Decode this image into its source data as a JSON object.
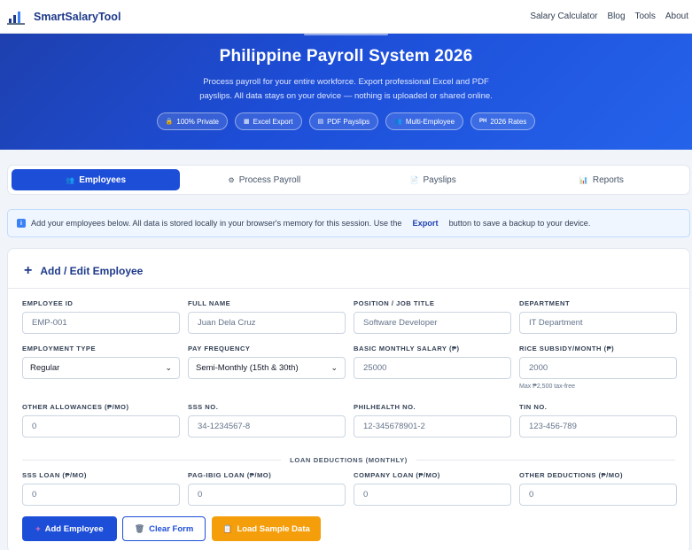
{
  "nav": {
    "brand": "SmartSalaryTool",
    "links": [
      "Salary Calculator",
      "Blog",
      "Tools",
      "About"
    ]
  },
  "hero": {
    "title": "Philippine Payroll System 2026",
    "desc_line1": "Process payroll for your entire workforce. Export professional Excel and PDF",
    "desc_line2": "payslips. All data stays on your device — nothing is uploaded or shared online.",
    "pills": [
      {
        "icon": "lock-icon",
        "label": "100% Private"
      },
      {
        "icon": "spreadsheet-icon",
        "label": "Excel Export"
      },
      {
        "icon": "document-icon",
        "label": "PDF Payslips"
      },
      {
        "icon": "people-icon",
        "label": "Multi-Employee"
      },
      {
        "icon": "ph-flag-icon",
        "label": "2026 Rates"
      }
    ]
  },
  "tabs": [
    {
      "icon": "people-icon",
      "label": "Employees",
      "active": true
    },
    {
      "icon": "gear-icon",
      "label": "Process Payroll",
      "active": false
    },
    {
      "icon": "document-icon",
      "label": "Payslips",
      "active": false
    },
    {
      "icon": "chart-icon",
      "label": "Reports",
      "active": false
    }
  ],
  "info": {
    "text_before": "Add your employees below. All data is stored locally in your browser's memory for this session. Use the",
    "bold": "Export",
    "text_after": "button to save a backup to your device."
  },
  "form": {
    "title": "Add / Edit Employee",
    "fields": {
      "employee_id": {
        "label": "EMPLOYEE ID",
        "placeholder": "EMP-001"
      },
      "full_name": {
        "label": "FULL NAME",
        "placeholder": "Juan Dela Cruz"
      },
      "position": {
        "label": "POSITION / JOB TITLE",
        "placeholder": "Software Developer"
      },
      "department": {
        "label": "DEPARTMENT",
        "placeholder": "IT Department"
      },
      "employment_type": {
        "label": "EMPLOYMENT TYPE",
        "value": "Regular"
      },
      "pay_frequency": {
        "label": "PAY FREQUENCY",
        "value": "Semi-Monthly (15th & 30th)"
      },
      "basic_salary": {
        "label": "BASIC MONTHLY SALARY (₱)",
        "placeholder": "25000"
      },
      "rice_subsidy": {
        "label": "RICE SUBSIDY/MONTH (₱)",
        "placeholder": "2000",
        "hint": "Max ₱2,500 tax-free"
      },
      "other_allowances": {
        "label": "OTHER ALLOWANCES (₱/MO)",
        "placeholder": "0"
      },
      "sss_no": {
        "label": "SSS NO.",
        "placeholder": "34-1234567-8"
      },
      "philhealth_no": {
        "label": "PHILHEALTH NO.",
        "placeholder": "12-345678901-2"
      },
      "tin_no": {
        "label": "TIN NO.",
        "placeholder": "123-456-789"
      },
      "sss_loan": {
        "label": "SSS LOAN (₱/MO)",
        "placeholder": "0"
      },
      "pagibig_loan": {
        "label": "PAG-IBIG LOAN (₱/MO)",
        "placeholder": "0"
      },
      "company_loan": {
        "label": "COMPANY LOAN (₱/MO)",
        "placeholder": "0"
      },
      "other_deductions": {
        "label": "OTHER DEDUCTIONS (₱/MO)",
        "placeholder": "0"
      }
    },
    "loan_section_label": "LOAN DEDUCTIONS (MONTHLY)",
    "buttons": {
      "add": "Add Employee",
      "clear": "Clear Form",
      "sample": "Load Sample Data"
    }
  },
  "colors": {
    "primary": "#1d4ed8",
    "hero_start": "#1e40af",
    "accent_amber": "#f59e0b",
    "brand_text": "#1e3a8a"
  }
}
